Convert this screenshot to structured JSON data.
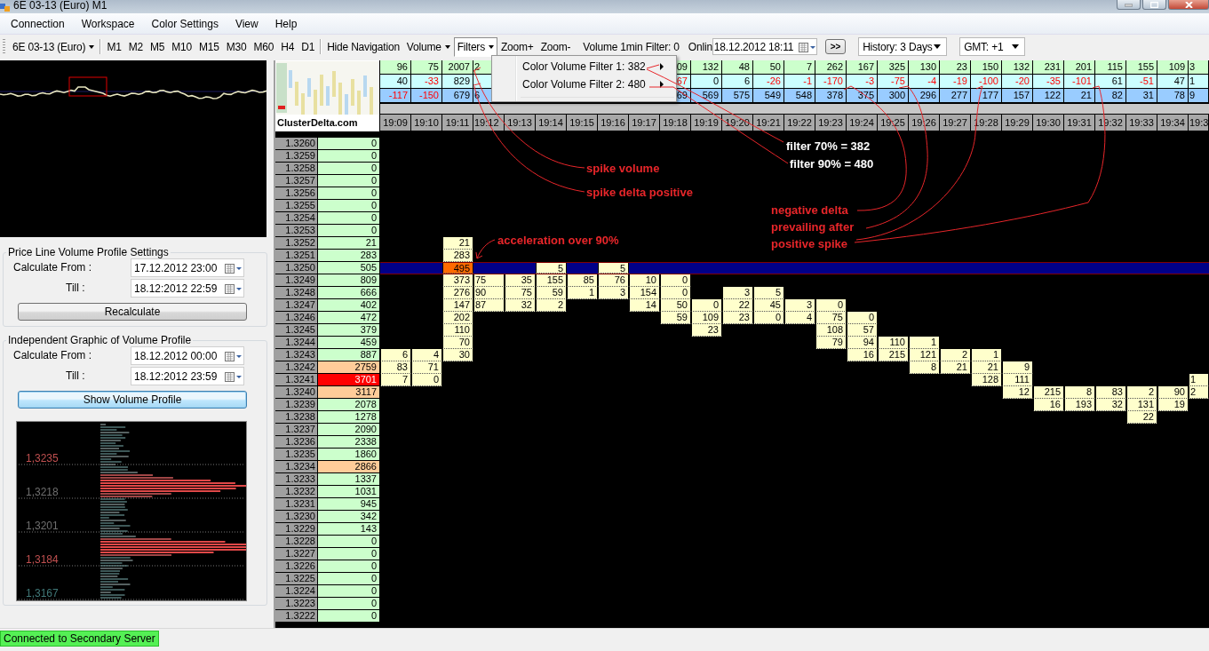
{
  "window": {
    "title": "6E 03-13 (Euro) M1"
  },
  "menu_bar": [
    "Connection",
    "Workspace",
    "Color Settings",
    "View",
    "Help"
  ],
  "toolbar": {
    "items": [
      {
        "kind": "combo",
        "label": "6E 03-13 (Euro)"
      },
      {
        "kind": "separator"
      },
      {
        "kind": "button",
        "label": "M1"
      },
      {
        "kind": "button",
        "label": "M2"
      },
      {
        "kind": "button",
        "label": "M5"
      },
      {
        "kind": "button",
        "label": "M10"
      },
      {
        "kind": "button",
        "label": "M15"
      },
      {
        "kind": "button",
        "label": "M30"
      },
      {
        "kind": "button",
        "label": "M60"
      },
      {
        "kind": "button",
        "label": "H4"
      },
      {
        "kind": "button",
        "label": "D1"
      },
      {
        "kind": "separator"
      },
      {
        "kind": "button",
        "label": "Hide Navigation"
      },
      {
        "kind": "dropdown",
        "label": "Volume",
        "open": false
      },
      {
        "kind": "dropdown",
        "label": "Filters",
        "open": true
      },
      {
        "kind": "button",
        "label": "Zoom+"
      },
      {
        "kind": "button",
        "label": "Zoom-"
      },
      {
        "kind": "label",
        "label": "Volume 1min Filter: 0"
      },
      {
        "kind": "label",
        "label": "Onlin"
      },
      {
        "kind": "date",
        "value": "18.12.2012 18:11"
      },
      {
        "kind": "push",
        "label": ">>"
      },
      {
        "kind": "select",
        "value": "History: 3 Days"
      },
      {
        "kind": "select",
        "value": "GMT: +1"
      }
    ]
  },
  "filters_menu": {
    "items": [
      "Color Volume Filter 1: 382",
      "Color Volume Filter 2: 480"
    ]
  },
  "price_line_settings": {
    "title": "Price Line Volume Profile Settings",
    "from_label": "Calculate From :",
    "from": "17.12.2012 23:00",
    "till_label": "Till :",
    "till": "18.12:2012 22:59",
    "button": "Recalculate"
  },
  "volume_profile_settings": {
    "title": "Independent Graphic of Volume Profile",
    "from_label": "Calculate From :",
    "from": "18.12.2012 00:00",
    "till_label": "Till :",
    "till": "18.12:2012 23:59",
    "button": "Show Volume Profile",
    "price_labels": [
      {
        "text": "1,3235",
        "color": "#c05050"
      },
      {
        "text": "1,3218",
        "color": "#707070"
      },
      {
        "text": "1,3201",
        "color": "#707070"
      },
      {
        "text": "1,3184",
        "color": "#c05050"
      },
      {
        "text": "1,3167",
        "color": "#407878"
      }
    ]
  },
  "cluster_chart": {
    "logo": "ClusterDelta.com",
    "columns": [
      {
        "time": "19:09",
        "volume": "96",
        "delta": "40",
        "delta_negative": false,
        "total": "-117",
        "total_negative": true,
        "cut": false
      },
      {
        "time": "19:10",
        "volume": "75",
        "delta": "-33",
        "delta_negative": true,
        "total": "-150",
        "total_negative": true,
        "cut": false
      },
      {
        "time": "19:11",
        "volume": "2007",
        "delta": "829",
        "delta_negative": false,
        "total": "679",
        "total_negative": false,
        "cut": false
      },
      {
        "time": "19:12",
        "volume": "2",
        "total": "6",
        "total_negative": false,
        "cut": true
      },
      {
        "time": "19:13",
        "cut": false
      },
      {
        "time": "19:14",
        "cut": false
      },
      {
        "time": "19:15",
        "cut": false
      },
      {
        "time": "19:16",
        "cut": false
      },
      {
        "time": "19:17",
        "cut": false
      },
      {
        "time": "19:18",
        "volume": "09",
        "delta": "67",
        "delta_negative": true,
        "total": "69",
        "total_negative": false,
        "cut": false
      },
      {
        "time": "19:19",
        "volume": "132",
        "delta": "0",
        "delta_negative": false,
        "total": "569",
        "total_negative": false,
        "cut": false
      },
      {
        "time": "19:20",
        "volume": "48",
        "delta": "6",
        "delta_negative": false,
        "total": "575",
        "total_negative": false,
        "cut": false
      },
      {
        "time": "19:21",
        "volume": "50",
        "delta": "-26",
        "delta_negative": true,
        "total": "549",
        "total_negative": false,
        "cut": false
      },
      {
        "time": "19:22",
        "volume": "7",
        "delta": "-1",
        "delta_negative": true,
        "total": "548",
        "total_negative": false,
        "cut": false
      },
      {
        "time": "19:23",
        "volume": "262",
        "delta": "-170",
        "delta_negative": true,
        "total": "378",
        "total_negative": false,
        "cut": false
      },
      {
        "time": "19:24",
        "volume": "167",
        "delta": "-3",
        "delta_negative": true,
        "total": "375",
        "total_negative": false,
        "cut": false
      },
      {
        "time": "19:25",
        "volume": "325",
        "delta": "-75",
        "delta_negative": true,
        "total": "300",
        "total_negative": false,
        "cut": false
      },
      {
        "time": "19:26",
        "volume": "130",
        "delta": "-4",
        "delta_negative": true,
        "total": "296",
        "total_negative": false,
        "cut": false
      },
      {
        "time": "19:27",
        "volume": "23",
        "delta": "-19",
        "delta_negative": true,
        "total": "277",
        "total_negative": false,
        "cut": false
      },
      {
        "time": "19:28",
        "volume": "150",
        "delta": "-100",
        "delta_negative": true,
        "total": "177",
        "total_negative": false,
        "cut": false
      },
      {
        "time": "19:29",
        "volume": "132",
        "delta": "-20",
        "delta_negative": true,
        "total": "157",
        "total_negative": false,
        "cut": false
      },
      {
        "time": "19:30",
        "volume": "231",
        "delta": "-35",
        "delta_negative": true,
        "total": "122",
        "total_negative": false,
        "cut": false
      },
      {
        "time": "19:31",
        "volume": "201",
        "delta": "-101",
        "delta_negative": true,
        "total": "21",
        "total_negative": false,
        "cut": false
      },
      {
        "time": "19:32",
        "volume": "115",
        "delta": "61",
        "delta_negative": false,
        "total": "82",
        "total_negative": false,
        "cut": false
      },
      {
        "time": "19:33",
        "volume": "155",
        "delta": "-51",
        "delta_negative": true,
        "total": "31",
        "total_negative": false,
        "cut": false
      },
      {
        "time": "19:34",
        "volume": "109",
        "delta": "47",
        "delta_negative": false,
        "total": "78",
        "total_negative": false,
        "cut": false
      },
      {
        "time": "19:3",
        "volume": "3",
        "delta": "1",
        "delta_negative": false,
        "total": "9",
        "total_negative": false,
        "cut": true
      }
    ],
    "rows": [
      {
        "price": "1.3260",
        "volume": "0",
        "kind": "normal",
        "current": false
      },
      {
        "price": "1.3259",
        "volume": "0",
        "kind": "normal",
        "current": false
      },
      {
        "price": "1.3258",
        "volume": "0",
        "kind": "normal",
        "current": false
      },
      {
        "price": "1.3257",
        "volume": "0",
        "kind": "normal",
        "current": false
      },
      {
        "price": "1.3256",
        "volume": "0",
        "kind": "normal",
        "current": false
      },
      {
        "price": "1.3255",
        "volume": "0",
        "kind": "normal",
        "current": false
      },
      {
        "price": "1.3254",
        "volume": "0",
        "kind": "normal",
        "current": false
      },
      {
        "price": "1.3253",
        "volume": "0",
        "kind": "normal",
        "current": false
      },
      {
        "price": "1.3252",
        "volume": "21",
        "kind": "normal",
        "current": false,
        "cells": [
          null,
          null,
          "21",
          null,
          null,
          null,
          null,
          null,
          null,
          null,
          null,
          null,
          null,
          null,
          null,
          null,
          null,
          null,
          null,
          null,
          null,
          null,
          null,
          null,
          null,
          null,
          null
        ]
      },
      {
        "price": "1.3251",
        "volume": "283",
        "kind": "normal",
        "current": false,
        "cells": [
          null,
          null,
          "283",
          null,
          null,
          null,
          null,
          null,
          null,
          null,
          null,
          null,
          null,
          null,
          null,
          null,
          null,
          null,
          null,
          null,
          null,
          null,
          null,
          null,
          null,
          null,
          null
        ]
      },
      {
        "price": "1.3250",
        "volume": "505",
        "kind": "normal",
        "current": true,
        "cells": [
          null,
          null,
          {
            "value": "495",
            "kind": "spike"
          },
          null,
          null,
          "5",
          null,
          "5",
          null,
          null,
          null,
          null,
          null,
          null,
          null,
          null,
          null,
          null,
          null,
          null,
          null,
          null,
          null,
          null,
          null,
          null,
          null
        ]
      },
      {
        "price": "1.3249",
        "volume": "809",
        "kind": "normal",
        "current": false,
        "cells": [
          null,
          null,
          "373",
          "75",
          "35",
          "155",
          "85",
          "76",
          "10",
          "0",
          null,
          null,
          null,
          null,
          null,
          null,
          null,
          null,
          null,
          null,
          null,
          null,
          null,
          null,
          null,
          null,
          null
        ]
      },
      {
        "price": "1.3248",
        "volume": "666",
        "kind": "normal",
        "current": false,
        "cells": [
          null,
          null,
          "276",
          "90",
          "75",
          "59",
          "1",
          "3",
          "154",
          "0",
          null,
          "3",
          "5",
          null,
          null,
          null,
          null,
          null,
          null,
          null,
          null,
          null,
          null,
          null,
          null,
          null,
          null
        ]
      },
      {
        "price": "1.3247",
        "volume": "402",
        "kind": "normal",
        "current": false,
        "cells": [
          null,
          null,
          "147",
          "87",
          "32",
          "2",
          null,
          null,
          "14",
          "50",
          "0",
          "22",
          "45",
          "3",
          "0",
          null,
          null,
          null,
          null,
          null,
          null,
          null,
          null,
          null,
          null,
          null,
          null
        ]
      },
      {
        "price": "1.3246",
        "volume": "472",
        "kind": "normal",
        "current": false,
        "cells": [
          null,
          null,
          "202",
          null,
          null,
          null,
          null,
          null,
          null,
          "59",
          "109",
          "23",
          "0",
          "4",
          "75",
          "0",
          null,
          null,
          null,
          null,
          null,
          null,
          null,
          null,
          null,
          null,
          null
        ]
      },
      {
        "price": "1.3245",
        "volume": "379",
        "kind": "normal",
        "current": false,
        "cells": [
          null,
          null,
          "110",
          null,
          null,
          null,
          null,
          null,
          null,
          null,
          "23",
          null,
          null,
          null,
          "108",
          "57",
          null,
          null,
          null,
          null,
          null,
          null,
          null,
          null,
          null,
          null,
          null
        ]
      },
      {
        "price": "1.3244",
        "volume": "459",
        "kind": "normal",
        "current": false,
        "cells": [
          null,
          null,
          "70",
          null,
          null,
          null,
          null,
          null,
          null,
          null,
          null,
          null,
          null,
          null,
          "79",
          "94",
          "110",
          "1",
          null,
          null,
          null,
          null,
          null,
          null,
          null,
          null,
          null
        ]
      },
      {
        "price": "1.3243",
        "volume": "887",
        "kind": "normal",
        "current": false,
        "cells": [
          "6",
          "4",
          "30",
          null,
          null,
          null,
          null,
          null,
          null,
          null,
          null,
          null,
          null,
          null,
          null,
          "16",
          "215",
          "121",
          "2",
          "1",
          null,
          null,
          null,
          null,
          null,
          null,
          null
        ]
      },
      {
        "price": "1.3242",
        "volume": "2759",
        "kind": "high",
        "current": false,
        "cells": [
          "83",
          "71",
          null,
          null,
          null,
          null,
          null,
          null,
          null,
          null,
          null,
          null,
          null,
          null,
          null,
          null,
          null,
          "8",
          "21",
          "21",
          "9",
          null,
          null,
          null,
          null,
          null,
          null
        ]
      },
      {
        "price": "1.3241",
        "volume": "3701",
        "kind": "peak",
        "current": false,
        "cells": [
          "7",
          "0",
          null,
          null,
          null,
          null,
          null,
          null,
          null,
          null,
          null,
          null,
          null,
          null,
          null,
          null,
          null,
          null,
          null,
          "128",
          "111",
          null,
          null,
          null,
          null,
          null,
          "1"
        ]
      },
      {
        "price": "1.3240",
        "volume": "3117",
        "kind": "high",
        "current": false,
        "cells": [
          null,
          null,
          null,
          null,
          null,
          null,
          null,
          null,
          null,
          null,
          null,
          null,
          null,
          null,
          null,
          null,
          null,
          null,
          null,
          null,
          "12",
          "215",
          "8",
          "83",
          "2",
          "90",
          "2"
        ]
      },
      {
        "price": "1.3239",
        "volume": "2078",
        "kind": "normal",
        "current": false,
        "cells": [
          null,
          null,
          null,
          null,
          null,
          null,
          null,
          null,
          null,
          null,
          null,
          null,
          null,
          null,
          null,
          null,
          null,
          null,
          null,
          null,
          null,
          "16",
          "193",
          "32",
          "131",
          "19",
          null
        ]
      },
      {
        "price": "1.3238",
        "volume": "1278",
        "kind": "normal",
        "current": false,
        "cells": [
          null,
          null,
          null,
          null,
          null,
          null,
          null,
          null,
          null,
          null,
          null,
          null,
          null,
          null,
          null,
          null,
          null,
          null,
          null,
          null,
          null,
          null,
          null,
          null,
          "22",
          null,
          null
        ]
      },
      {
        "price": "1.3237",
        "volume": "2090",
        "kind": "normal",
        "current": false
      },
      {
        "price": "1.3236",
        "volume": "2338",
        "kind": "normal",
        "current": false
      },
      {
        "price": "1.3235",
        "volume": "1860",
        "kind": "normal",
        "current": false
      },
      {
        "price": "1.3234",
        "volume": "2866",
        "kind": "high",
        "current": false
      },
      {
        "price": "1.3233",
        "volume": "1337",
        "kind": "normal",
        "current": false
      },
      {
        "price": "1.3232",
        "volume": "1031",
        "kind": "normal",
        "current": false
      },
      {
        "price": "1.3231",
        "volume": "945",
        "kind": "normal",
        "current": false
      },
      {
        "price": "1.3230",
        "volume": "342",
        "kind": "normal",
        "current": false
      },
      {
        "price": "1.3229",
        "volume": "143",
        "kind": "normal",
        "current": false
      },
      {
        "price": "1.3228",
        "volume": "0",
        "kind": "normal",
        "current": false
      },
      {
        "price": "1.3227",
        "volume": "0",
        "kind": "normal",
        "current": false
      },
      {
        "price": "1.3226",
        "volume": "0",
        "kind": "normal",
        "current": false
      },
      {
        "price": "1.3225",
        "volume": "0",
        "kind": "normal",
        "current": false
      },
      {
        "price": "1.3224",
        "volume": "0",
        "kind": "normal",
        "current": false
      },
      {
        "price": "1.3223",
        "volume": "0",
        "kind": "normal",
        "current": false
      },
      {
        "price": "1.3222",
        "volume": "0",
        "kind": "normal",
        "current": false
      }
    ]
  },
  "annotations": [
    {
      "kind": "red",
      "text": "spike volume"
    },
    {
      "kind": "red",
      "text": "spike delta positive"
    },
    {
      "kind": "white",
      "text": "filter 70% = 382"
    },
    {
      "kind": "white",
      "text": "filter 90% = 480"
    },
    {
      "kind": "red",
      "text": "negative delta\nprevailing after\npositive spike"
    },
    {
      "kind": "red",
      "text": "acceleration over 90%"
    }
  ],
  "status_bar": {
    "connection": "Connected to Secondary Server"
  }
}
